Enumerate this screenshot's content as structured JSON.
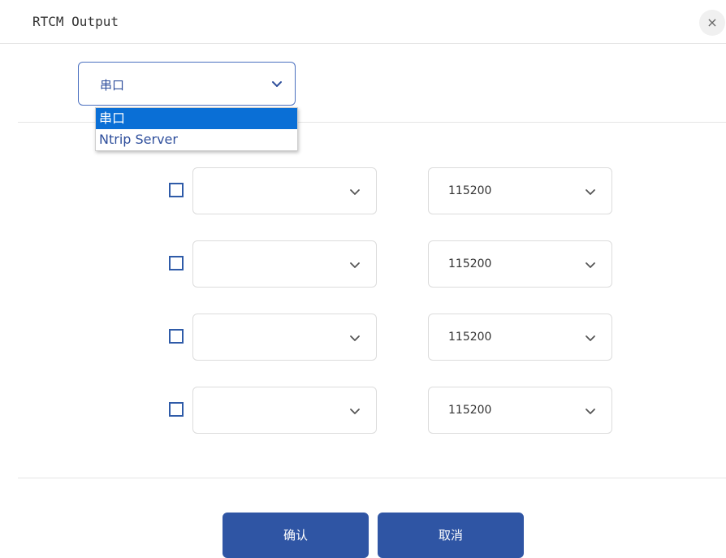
{
  "dialog": {
    "title": "RTCM Output",
    "close_label": "×"
  },
  "mode_select": {
    "value": "串口",
    "options": [
      "串口",
      "Ntrip Server"
    ],
    "selected_index": 0
  },
  "serial_rows": [
    {
      "checked": false,
      "port": "",
      "baud": "115200"
    },
    {
      "checked": false,
      "port": "",
      "baud": "115200"
    },
    {
      "checked": false,
      "port": "",
      "baud": "115200"
    },
    {
      "checked": false,
      "port": "",
      "baud": "115200"
    }
  ],
  "buttons": {
    "confirm_label": "确认",
    "cancel_label": "取消"
  },
  "colors": {
    "primary": "#2f55a4",
    "selected_option": "#0a6fd6",
    "accent_text": "#2f4f9c"
  },
  "icons": {
    "close": "close-icon",
    "chevron": "chevron-down-icon"
  }
}
